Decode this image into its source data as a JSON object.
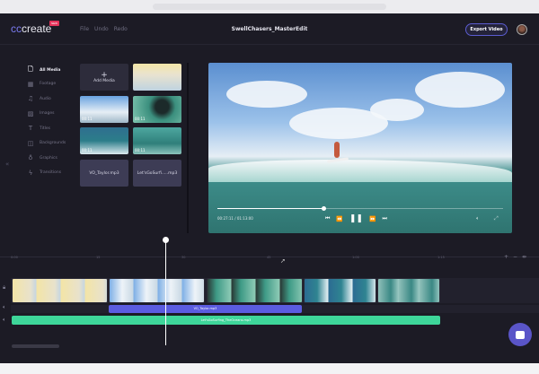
{
  "header": {
    "logo_cc": "cc",
    "logo_text": "create",
    "logo_badge": "NEW",
    "menu": [
      "File",
      "Undo",
      "Redo"
    ],
    "title": "SwellChasers_MasterEdit",
    "export_label": "Export Video"
  },
  "sidebar": {
    "items": [
      {
        "label": "All Media",
        "icon": "file-icon"
      },
      {
        "label": "Footage",
        "icon": "film-icon"
      },
      {
        "label": "Audio",
        "icon": "music-icon"
      },
      {
        "label": "Images",
        "icon": "image-icon"
      },
      {
        "label": "Titles",
        "icon": "text-icon"
      },
      {
        "label": "Backgrounds",
        "icon": "layers-icon"
      },
      {
        "label": "Graphics",
        "icon": "bulb-icon"
      },
      {
        "label": "Transitions",
        "icon": "bolt-icon"
      }
    ],
    "collapse": "«"
  },
  "media": {
    "add_label": "Add Media",
    "durations": [
      "00:11",
      "00:11",
      "00:11",
      "00:11"
    ],
    "audio": [
      "VO_Taylor.mp3",
      "Let'sGoSurfi.....mp3"
    ]
  },
  "player": {
    "time": "00:27:11 / 01:13:00",
    "progress_percent": 37
  },
  "timeline": {
    "ticks": [
      "0:00",
      "15",
      "30",
      "45",
      "1:00",
      "1:15"
    ],
    "voice_clip": "VO_Taylor.mp3",
    "music_clip": "Let'sGoSurfing_TheOceans.mp3",
    "accent_blue": "#5b5ce0",
    "accent_green": "#3ed69a"
  }
}
